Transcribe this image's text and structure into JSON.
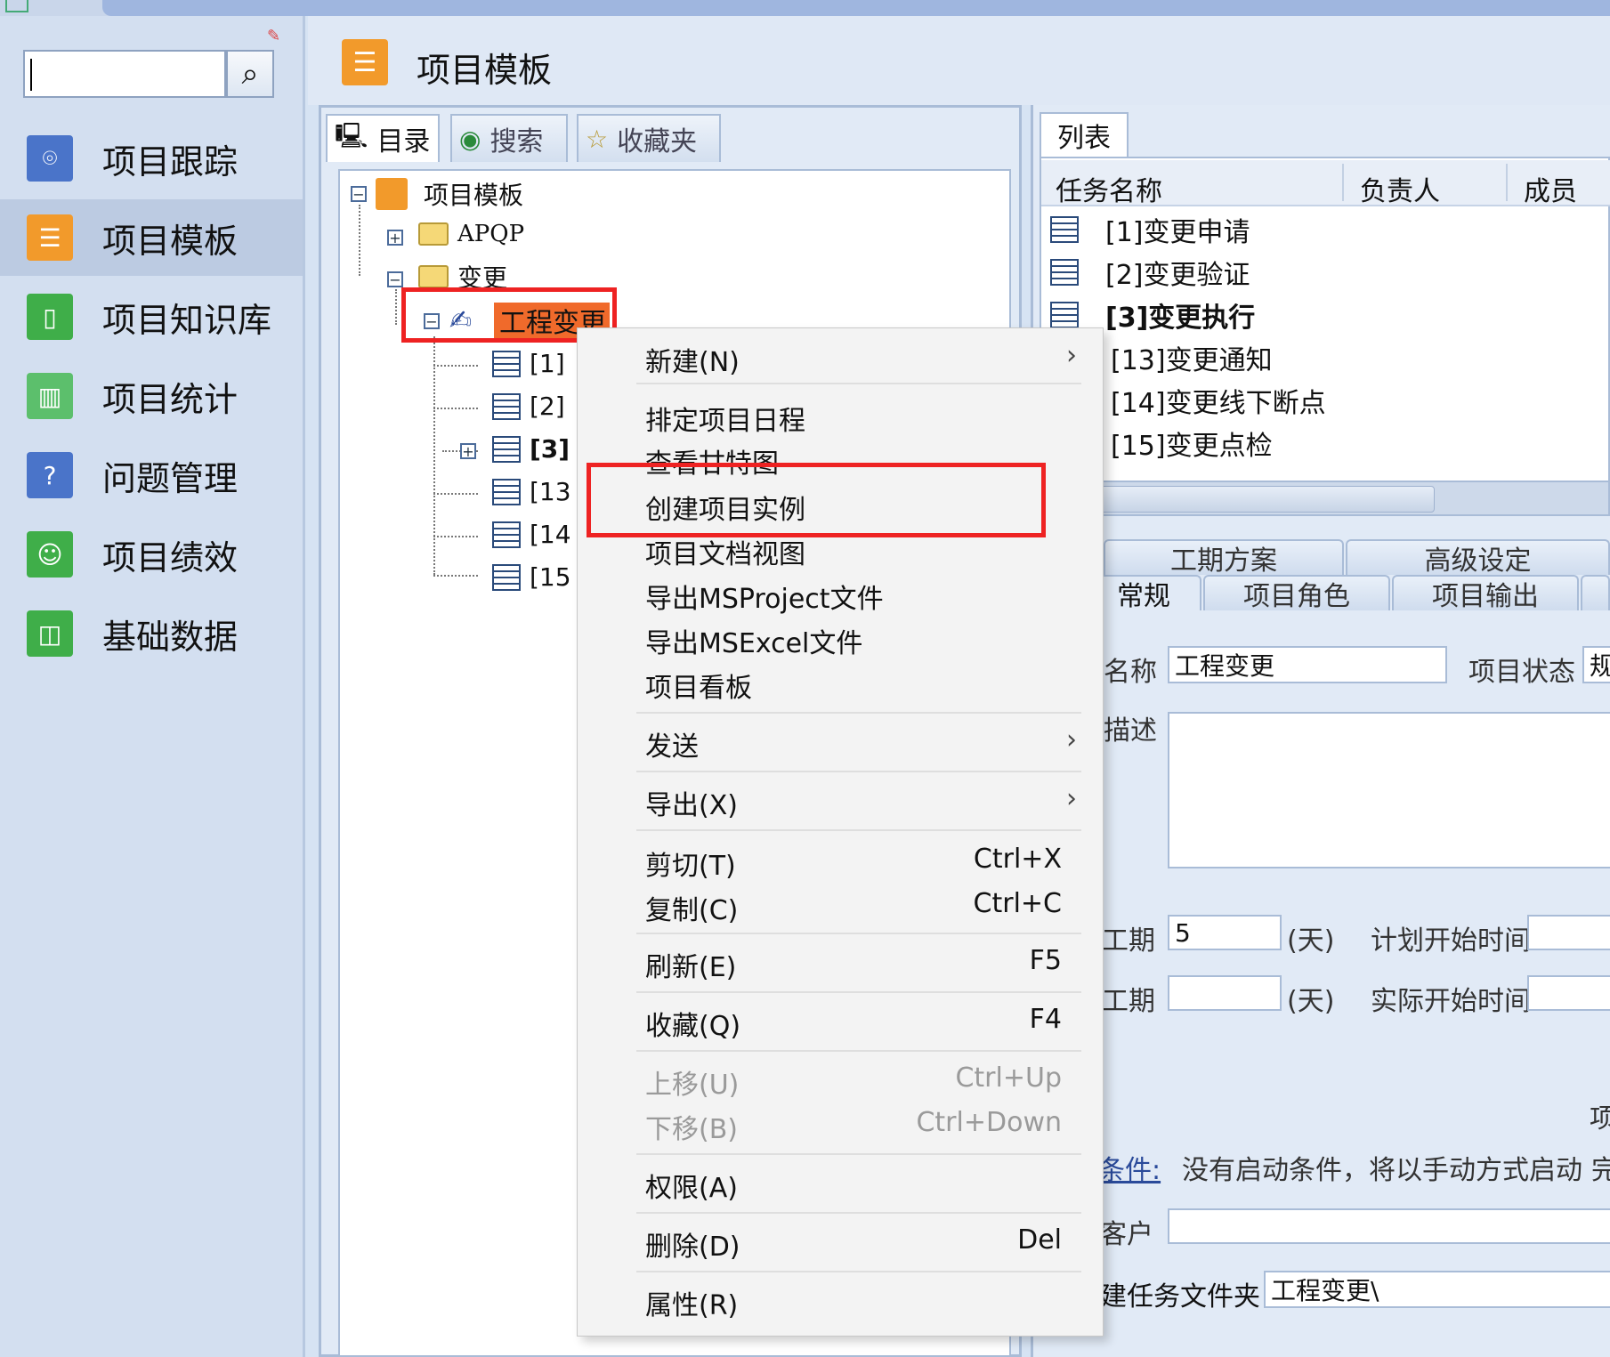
{
  "sidebar": {
    "items": [
      {
        "label": "项目跟踪",
        "icon": "location-icon",
        "color": "#4a74c9",
        "active": false
      },
      {
        "label": "项目模板",
        "icon": "template-icon",
        "color": "#f29a2b",
        "active": true
      },
      {
        "label": "项目知识库",
        "icon": "book-icon",
        "color": "#3fae49",
        "active": false
      },
      {
        "label": "项目统计",
        "icon": "bar-chart-icon",
        "color": "#5cbf6c",
        "active": false
      },
      {
        "label": "问题管理",
        "icon": "question-icon",
        "color": "#4a74c9",
        "active": false
      },
      {
        "label": "项目绩效",
        "icon": "person-icon",
        "color": "#3fae49",
        "active": false
      },
      {
        "label": "基础数据",
        "icon": "open-book-icon",
        "color": "#3fae49",
        "active": false
      }
    ]
  },
  "header": {
    "title": "项目模板"
  },
  "left_tabs": {
    "catalog": "目录",
    "search": "搜索",
    "favorites": "收藏夹"
  },
  "tree": {
    "root": "项目模板",
    "folder_apqp": "APQP",
    "folder_change": "变更",
    "selected_node": "工程变更",
    "children": [
      "[1]",
      "[2]",
      "[3]",
      "[13",
      "[14",
      "[15"
    ]
  },
  "list": {
    "tab": "列表",
    "columns": [
      "任务名称",
      "负责人",
      "成员"
    ],
    "rows": [
      {
        "name": "[1]变更申请",
        "bold": false
      },
      {
        "name": "[2]变更验证",
        "bold": false
      },
      {
        "name": "[3]变更执行",
        "bold": true
      },
      {
        "name": "[13]变更通知",
        "bold": false
      },
      {
        "name": "[14]变更线下断点",
        "bold": false
      },
      {
        "name": "[15]变更点检",
        "bold": false
      }
    ]
  },
  "detail": {
    "tabs_row1": [
      "工期方案",
      "高级设定"
    ],
    "tabs_row2": [
      "常规",
      "项目角色",
      "项目输出"
    ],
    "name_label": "名称",
    "name_value": "工程变更",
    "status_label": "项目状态",
    "status_value": "规",
    "desc_label": "描述",
    "duration_label": "工期",
    "duration_value": "5",
    "day_unit": "(天)",
    "plan_start_label": "计划开始时间",
    "actual_duration_label": "工期",
    "actual_start_label": "实际开始时间",
    "side_char": "项",
    "condition_label": "条件:",
    "condition_text": "没有启动条件，将以手动方式启动",
    "condition_side": "完",
    "customer_label": "客户",
    "folder_label": "建任务文件夹",
    "folder_value": "工程变更\\"
  },
  "context_menu": {
    "items": [
      {
        "label": "新建(N)",
        "shortcut": "",
        "submenu": true,
        "disabled": false
      },
      {
        "label": "排定项目日程",
        "shortcut": "",
        "submenu": false,
        "disabled": false
      },
      {
        "label": "查看甘特图",
        "shortcut": "",
        "submenu": false,
        "disabled": false
      },
      {
        "label": "创建项目实例",
        "shortcut": "",
        "submenu": false,
        "disabled": false
      },
      {
        "label": "项目文档视图",
        "shortcut": "",
        "submenu": false,
        "disabled": false
      },
      {
        "label": "导出MSProject文件",
        "shortcut": "",
        "submenu": false,
        "disabled": false
      },
      {
        "label": "导出MSExcel文件",
        "shortcut": "",
        "submenu": false,
        "disabled": false
      },
      {
        "label": "项目看板",
        "shortcut": "",
        "submenu": false,
        "disabled": false
      },
      {
        "label": "发送",
        "shortcut": "",
        "submenu": true,
        "disabled": false
      },
      {
        "label": "导出(X)",
        "shortcut": "",
        "submenu": true,
        "disabled": false
      },
      {
        "label": "剪切(T)",
        "shortcut": "Ctrl+X",
        "submenu": false,
        "disabled": false
      },
      {
        "label": "复制(C)",
        "shortcut": "Ctrl+C",
        "submenu": false,
        "disabled": false
      },
      {
        "label": "刷新(E)",
        "shortcut": "F5",
        "submenu": false,
        "disabled": false
      },
      {
        "label": "收藏(Q)",
        "shortcut": "F4",
        "submenu": false,
        "disabled": false
      },
      {
        "label": "上移(U)",
        "shortcut": "Ctrl+Up",
        "submenu": false,
        "disabled": true
      },
      {
        "label": "下移(B)",
        "shortcut": "Ctrl+Down",
        "submenu": false,
        "disabled": true
      },
      {
        "label": "权限(A)",
        "shortcut": "",
        "submenu": false,
        "disabled": false
      },
      {
        "label": "删除(D)",
        "shortcut": "Del",
        "submenu": false,
        "disabled": false
      },
      {
        "label": "属性(R)",
        "shortcut": "",
        "submenu": false,
        "disabled": false
      }
    ]
  }
}
